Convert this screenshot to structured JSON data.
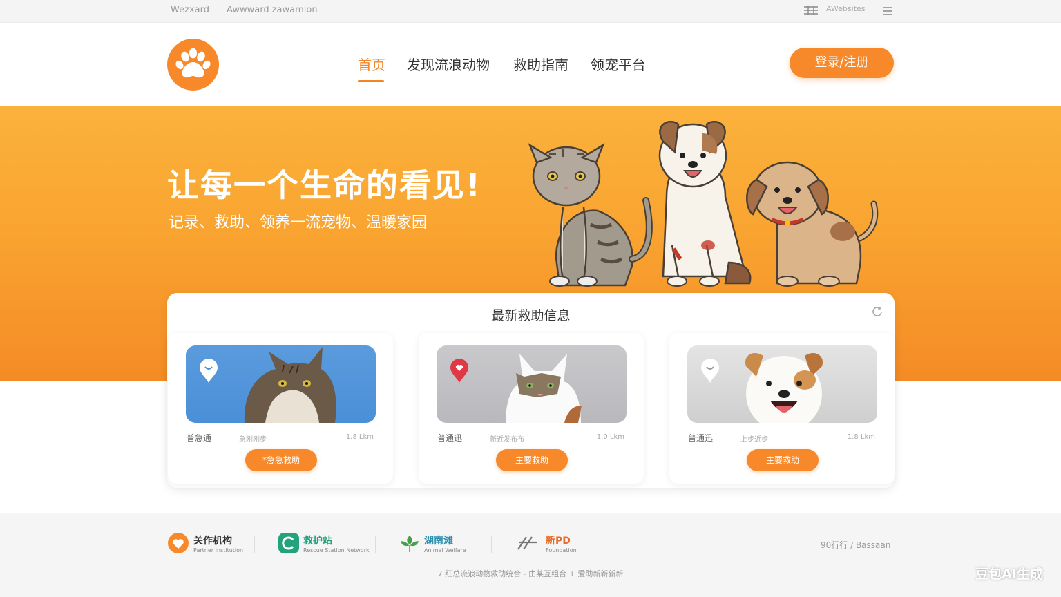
{
  "topbar": {
    "left_links": [
      "Wezxard",
      "Awwward  zawamion"
    ],
    "right_text": "AWebsites"
  },
  "header": {
    "nav": [
      "首页",
      "发现流浪动物",
      "救助指南",
      "领宠平台"
    ],
    "login_label": "登录/注册"
  },
  "hero": {
    "title": "让每一个生命的看见!",
    "subtitle": "记录、救助、领养一流宠物、温暖家园"
  },
  "rescue": {
    "title": "最新救助信息",
    "cards": [
      {
        "type": "普急通",
        "meta": "急刚刚步",
        "distance": "1.8 Lkm",
        "button": "*急急救助"
      },
      {
        "type": "普通迅",
        "meta": "新近发布布",
        "distance": "1.0 Lkm",
        "button": "主要救助"
      },
      {
        "type": "普通迅",
        "meta": "上步近步",
        "distance": "1.8 Lkm",
        "button": "主要救助"
      }
    ]
  },
  "footer": {
    "partners": [
      {
        "name": "关作机构",
        "sub": "Partner Institution"
      },
      {
        "name": "救护站",
        "sub": "Rescue Station Network"
      },
      {
        "name": "湖南滩",
        "sub": "Animal Welfare"
      },
      {
        "name": "新PD",
        "sub": "Foundation"
      }
    ],
    "right_text": "90行行  /  Bassaan",
    "copyright": "7 红总流浪动物救助统合 - 由某互组合 + 爱助新新新新",
    "watermark": "豆包AI生成"
  },
  "colors": {
    "accent": "#f7892a",
    "hero_top": "#fbb23c",
    "hero_bottom": "#f48b25"
  }
}
